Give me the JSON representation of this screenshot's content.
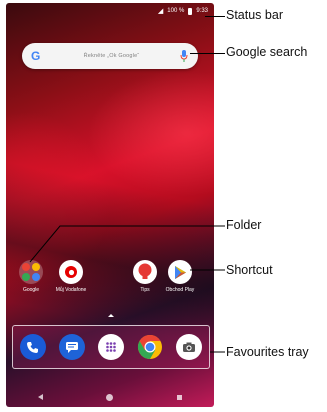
{
  "status_bar": {
    "signal_icon": "signal-icon",
    "battery_percent": "100 %",
    "time": "9:33"
  },
  "search": {
    "logo": "G",
    "hint": "Řekněte „Ok Google“"
  },
  "home_apps": [
    {
      "label": "Google",
      "icon": "folder-icon"
    },
    {
      "label": "Můj Vodafone",
      "icon": "vodafone-icon"
    },
    {
      "label": "Tips",
      "icon": "tips-icon"
    },
    {
      "label": "Obchod Play",
      "icon": "play-store-icon"
    }
  ],
  "tray": [
    {
      "icon": "phone-icon"
    },
    {
      "icon": "messages-icon"
    },
    {
      "icon": "app-drawer-icon"
    },
    {
      "icon": "chrome-icon"
    },
    {
      "icon": "camera-icon"
    }
  ],
  "annotations": {
    "status_bar": "Status bar",
    "google_search": "Google search",
    "folder": "Folder",
    "shortcut": "Shortcut",
    "favourites_tray": "Favourites tray"
  },
  "colors": {
    "annotation_line": "#000000",
    "wallpaper_red": "#d8112a",
    "google_blue": "#4285f4",
    "vodafone_red": "#e60000",
    "tips_red": "#e53935",
    "phone_blue": "#1a5bd6"
  }
}
